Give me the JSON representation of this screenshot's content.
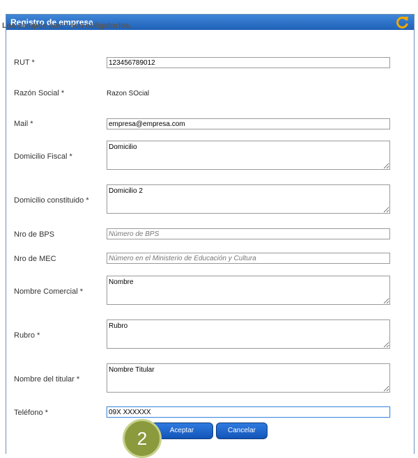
{
  "dialog": {
    "title": "Registro de empresa",
    "required_note": "Los campos con * son obligatorios."
  },
  "fields": {
    "rut": {
      "label": "RUT *",
      "value": "123456789012"
    },
    "razon_social": {
      "label": "Razón Social *",
      "value": "Razon SOcial"
    },
    "mail": {
      "label": "Mail *",
      "value": "empresa@empresa.com"
    },
    "domicilio_fiscal": {
      "label": "Domicilio Fiscal *",
      "value": "Domicilio"
    },
    "domicilio_constituido": {
      "label": "Domicilio constituido *",
      "value": "Domicilio 2"
    },
    "nro_bps": {
      "label": "Nro de BPS",
      "placeholder": "Número de BPS"
    },
    "nro_mec": {
      "label": "Nro de MEC",
      "placeholder": "Número en el Ministerio de Educación y Cultura"
    },
    "nombre_comercial": {
      "label": "Nombre Comercial *",
      "value": "Nombre"
    },
    "rubro": {
      "label": "Rubro *",
      "value": "Rubro"
    },
    "nombre_titular": {
      "label": "Nombre del titular *",
      "value": "Nombre Titular"
    },
    "telefono": {
      "label": "Teléfono *",
      "value": "09X XXXXXX"
    }
  },
  "buttons": {
    "accept": "Aceptar",
    "cancel": "Cancelar"
  },
  "step_badge": "2",
  "colors": {
    "titlebar": "#1f61b8",
    "button": "#1354b8",
    "badge": "#8a9a3d",
    "refresh_icon": "#f2a900"
  }
}
